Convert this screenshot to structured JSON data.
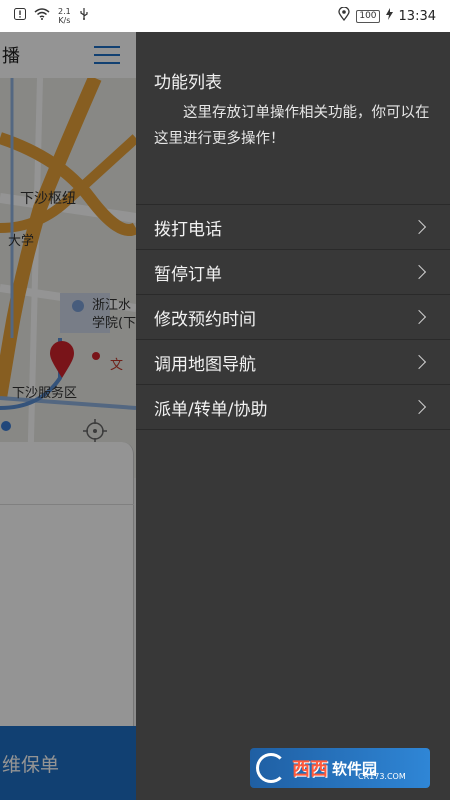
{
  "status_bar": {
    "net_speed_value": "2.1",
    "net_speed_unit": "K/s",
    "battery": "100",
    "time": "13:34"
  },
  "app": {
    "header_title": "播",
    "bottom_button": "维保单",
    "map_labels": {
      "hub": "下沙枢纽",
      "university": "大学",
      "college": "浙江水",
      "college2": "学院(下",
      "service_area": "下沙服务区",
      "wen": "文"
    }
  },
  "drawer": {
    "title": "功能列表",
    "description": "这里存放订单操作相关功能，你可以在这里进行更多操作！",
    "items": [
      {
        "label": "拨打电话"
      },
      {
        "label": "暂停订单"
      },
      {
        "label": "修改预约时间"
      },
      {
        "label": "调用地图导航"
      },
      {
        "label": "派单/转单/协助"
      }
    ]
  },
  "watermark": {
    "brand": "西西",
    "suffix": "软件园",
    "url": "CR173.COM"
  },
  "colors": {
    "accent_blue": "#1e6fc4",
    "drawer_bg": "#383838",
    "map_road": "#e8a23a",
    "marker_red": "#d0242b"
  }
}
